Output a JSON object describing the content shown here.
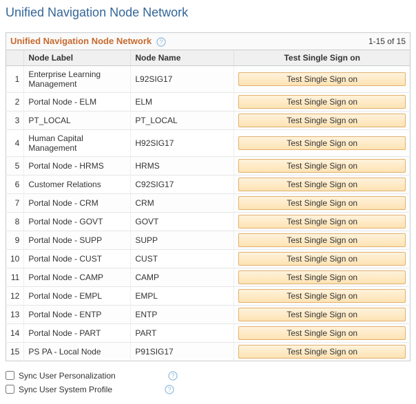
{
  "page": {
    "title": "Unified Navigation Node Network"
  },
  "grid": {
    "title": "Unified Navigation Node Network",
    "range": "1-15 of 15",
    "columns": {
      "label": "Node Label",
      "name": "Node Name",
      "action": "Test Single Sign on"
    },
    "button_label": "Test Single Sign on",
    "rows": [
      {
        "idx": "1",
        "label": "Enterprise Learning Management",
        "name": "L92SIG17"
      },
      {
        "idx": "2",
        "label": "Portal Node - ELM",
        "name": "ELM"
      },
      {
        "idx": "3",
        "label": "PT_LOCAL",
        "name": "PT_LOCAL"
      },
      {
        "idx": "4",
        "label": "Human Capital Management",
        "name": "H92SIG17"
      },
      {
        "idx": "5",
        "label": "Portal Node - HRMS",
        "name": "HRMS"
      },
      {
        "idx": "6",
        "label": "Customer Relations",
        "name": "C92SIG17"
      },
      {
        "idx": "7",
        "label": "Portal Node - CRM",
        "name": "CRM"
      },
      {
        "idx": "8",
        "label": "Portal Node - GOVT",
        "name": "GOVT"
      },
      {
        "idx": "9",
        "label": "Portal Node - SUPP",
        "name": "SUPP"
      },
      {
        "idx": "10",
        "label": "Portal Node - CUST",
        "name": "CUST"
      },
      {
        "idx": "11",
        "label": "Portal Node - CAMP",
        "name": "CAMP"
      },
      {
        "idx": "12",
        "label": "Portal Node - EMPL",
        "name": "EMPL"
      },
      {
        "idx": "13",
        "label": "Portal Node - ENTP",
        "name": "ENTP"
      },
      {
        "idx": "14",
        "label": "Portal Node - PART",
        "name": "PART"
      },
      {
        "idx": "15",
        "label": "PS PA - Local Node",
        "name": "P91SIG17"
      }
    ]
  },
  "options": {
    "sync_personalization": "Sync User Personalization",
    "sync_system_profile": "Sync User System Profile"
  },
  "icons": {
    "help": "help-icon"
  }
}
